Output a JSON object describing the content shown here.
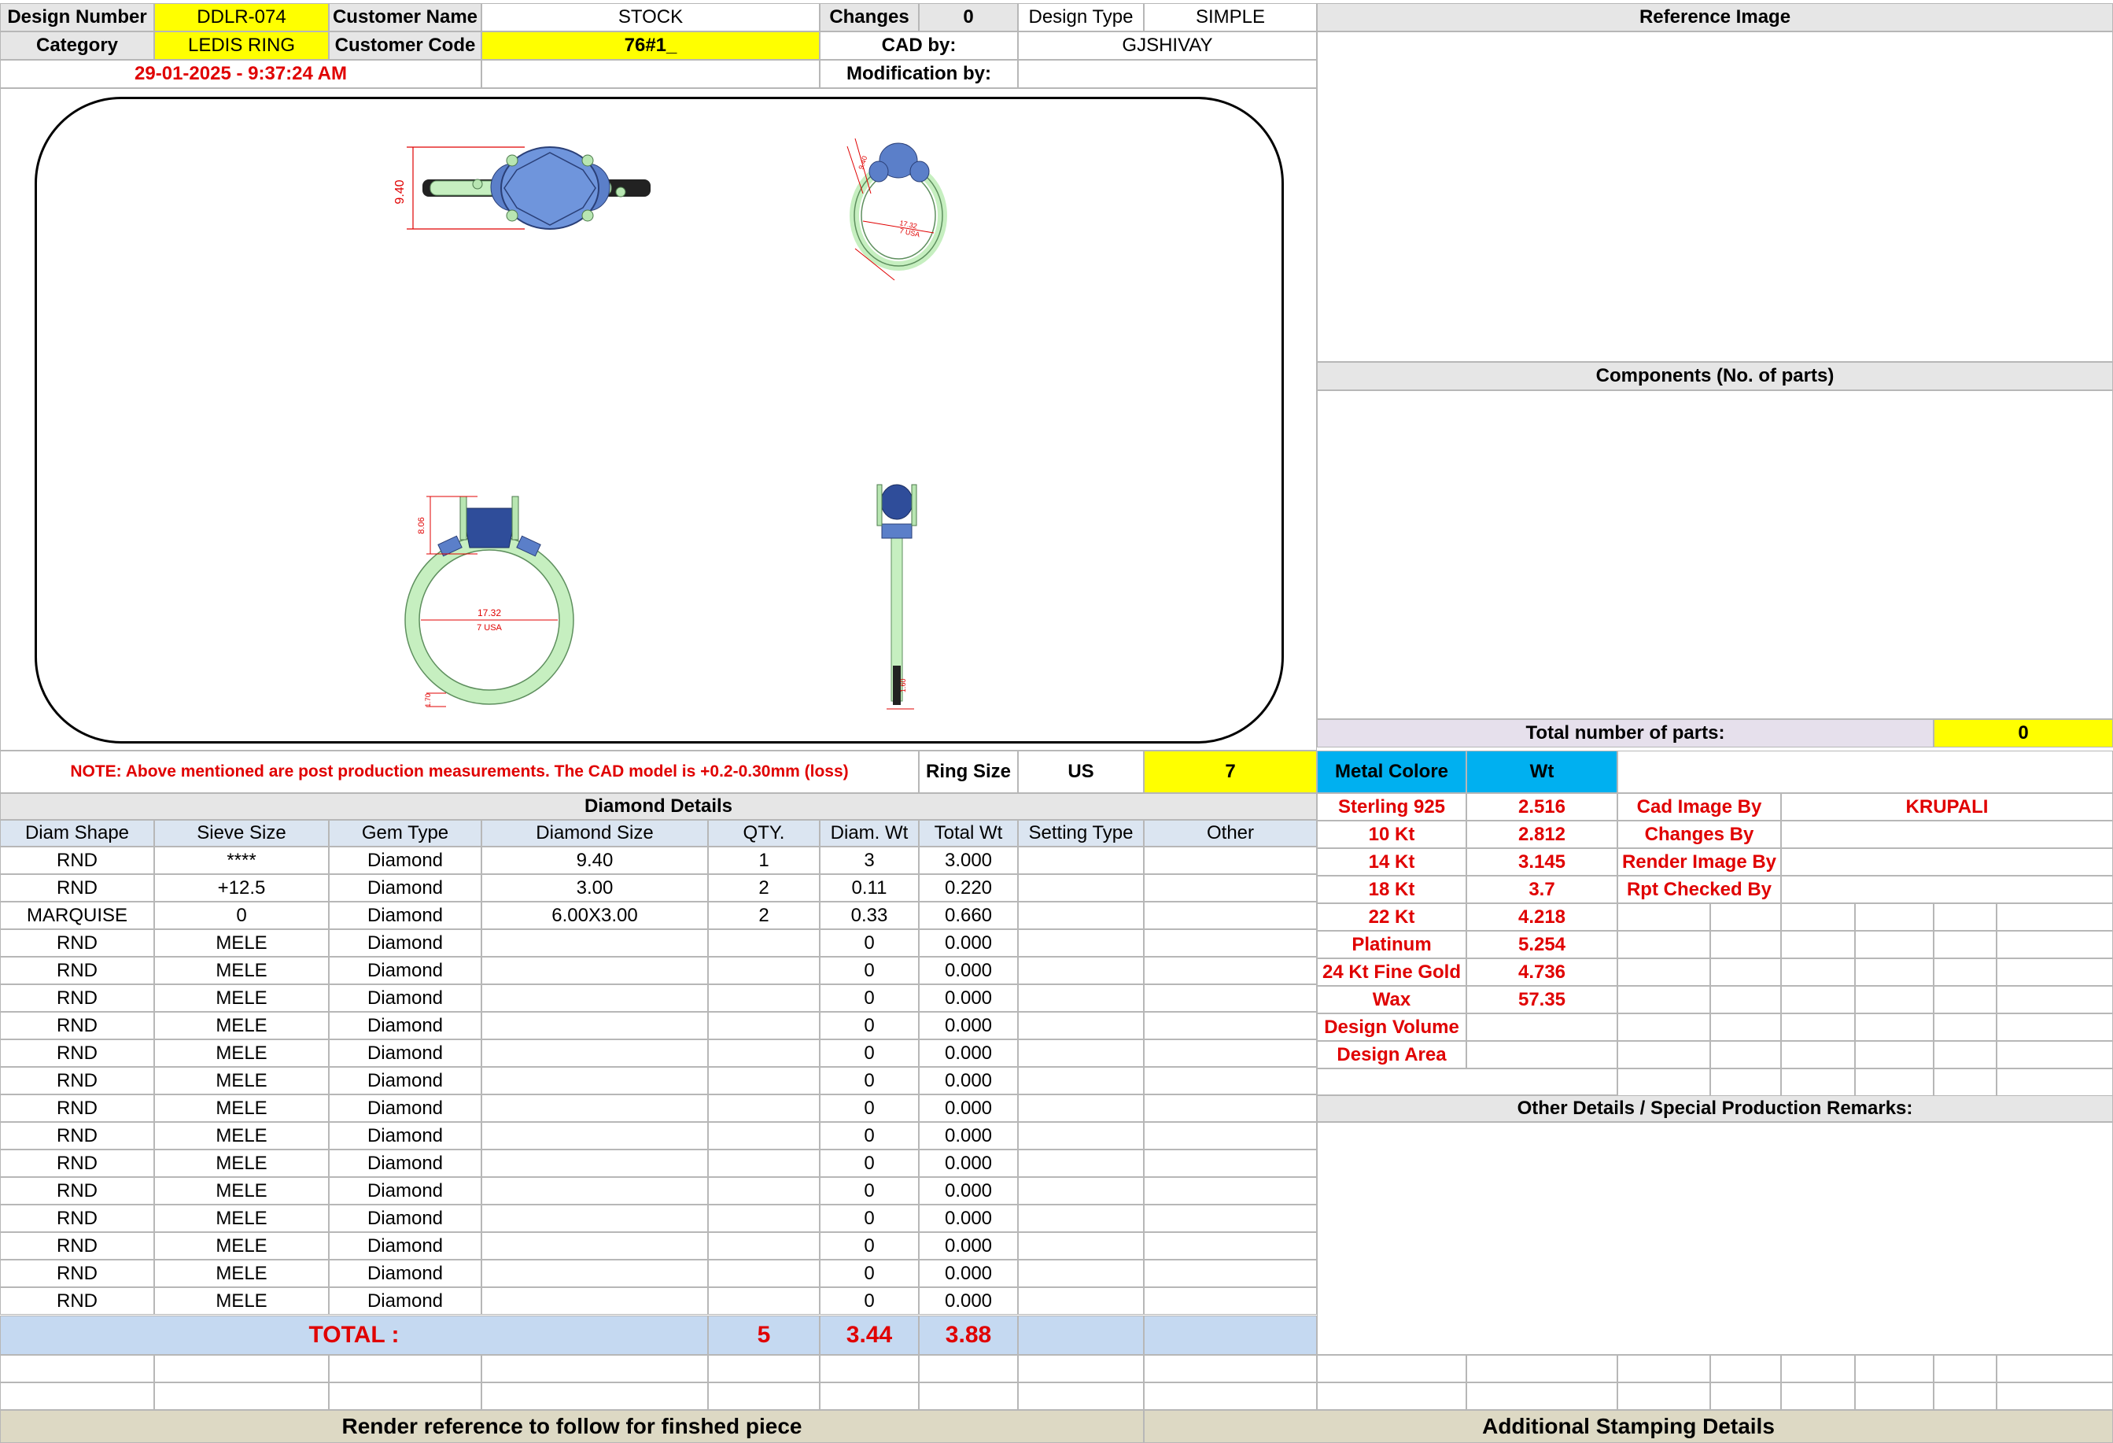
{
  "header": {
    "design_number_label": "Design Number",
    "design_number": "DDLR-074",
    "customer_name_label": "Customer Name",
    "customer_name": "STOCK",
    "changes_label": "Changes",
    "changes": "0",
    "design_type_label": "Design Type",
    "design_type": "SIMPLE",
    "category_label": "Category",
    "category": "LEDIS RING",
    "customer_code_label": "Customer Code",
    "customer_code": "76#1_",
    "cad_by_label": "CAD by:",
    "cad_by": "GJSHIVAY",
    "timestamp": "29-01-2025 - 9:37:24 AM",
    "modification_label": "Modification by:",
    "modification": ""
  },
  "drawing": {
    "top_view": {
      "height_dim": "9.40"
    },
    "iso_view": {
      "height_dim": "9.40",
      "inner_dim": "17.32",
      "size_dim": "7 USA"
    },
    "front_view": {
      "height_dim": "8.06",
      "inner_dim": "17.32",
      "size_dim": "7 USA",
      "band_dim": "1.70"
    },
    "side_view": {
      "band_dim": "1.60"
    }
  },
  "note": "NOTE: Above mentioned are post production measurements. The CAD model is +0.2-0.30mm (loss)",
  "ring_size": {
    "label": "Ring Size",
    "system": "US",
    "value": "7"
  },
  "reference_image_title": "Reference Image",
  "components_title": "Components (No. of parts)",
  "total_parts": {
    "label": "Total number of parts:",
    "value": "0"
  },
  "diamond_details": {
    "title": "Diamond Details",
    "columns": [
      "Diam Shape",
      "Sieve Size",
      "Gem Type",
      "Diamond Size",
      "QTY.",
      "Diam. Wt",
      "Total Wt",
      "Setting Type",
      "Other"
    ],
    "rows": [
      [
        "RND",
        "****",
        "Diamond",
        "9.40",
        "1",
        "3",
        "3.000",
        "",
        ""
      ],
      [
        "RND",
        "+12.5",
        "Diamond",
        "3.00",
        "2",
        "0.11",
        "0.220",
        "",
        ""
      ],
      [
        "MARQUISE",
        "0",
        "Diamond",
        "6.00X3.00",
        "2",
        "0.33",
        "0.660",
        "",
        ""
      ],
      [
        "RND",
        "MELE",
        "Diamond",
        "",
        "",
        "0",
        "0.000",
        "",
        ""
      ],
      [
        "RND",
        "MELE",
        "Diamond",
        "",
        "",
        "0",
        "0.000",
        "",
        ""
      ],
      [
        "RND",
        "MELE",
        "Diamond",
        "",
        "",
        "0",
        "0.000",
        "",
        ""
      ],
      [
        "RND",
        "MELE",
        "Diamond",
        "",
        "",
        "0",
        "0.000",
        "",
        ""
      ],
      [
        "RND",
        "MELE",
        "Diamond",
        "",
        "",
        "0",
        "0.000",
        "",
        ""
      ],
      [
        "RND",
        "MELE",
        "Diamond",
        "",
        "",
        "0",
        "0.000",
        "",
        ""
      ],
      [
        "RND",
        "MELE",
        "Diamond",
        "",
        "",
        "0",
        "0.000",
        "",
        ""
      ],
      [
        "RND",
        "MELE",
        "Diamond",
        "",
        "",
        "0",
        "0.000",
        "",
        ""
      ],
      [
        "RND",
        "MELE",
        "Diamond",
        "",
        "",
        "0",
        "0.000",
        "",
        ""
      ],
      [
        "RND",
        "MELE",
        "Diamond",
        "",
        "",
        "0",
        "0.000",
        "",
        ""
      ],
      [
        "RND",
        "MELE",
        "Diamond",
        "",
        "",
        "0",
        "0.000",
        "",
        ""
      ],
      [
        "RND",
        "MELE",
        "Diamond",
        "",
        "",
        "0",
        "0.000",
        "",
        ""
      ],
      [
        "RND",
        "MELE",
        "Diamond",
        "",
        "",
        "0",
        "0.000",
        "",
        ""
      ],
      [
        "RND",
        "MELE",
        "Diamond",
        "",
        "",
        "0",
        "0.000",
        "",
        ""
      ]
    ],
    "total_label": "TOTAL :",
    "total_qty": "5",
    "total_diam_wt": "3.44",
    "total_wt": "3.88"
  },
  "metal": {
    "header_label": "Metal Colore",
    "wt_label": "Wt",
    "rows": [
      {
        "name": "Sterling 925",
        "wt": "2.516"
      },
      {
        "name": "10 Kt",
        "wt": "2.812"
      },
      {
        "name": "14 Kt",
        "wt": "3.145"
      },
      {
        "name": "18 Kt",
        "wt": "3.7"
      },
      {
        "name": "22 Kt",
        "wt": "4.218"
      },
      {
        "name": "Platinum",
        "wt": "5.254"
      },
      {
        "name": "24 Kt Fine Gold",
        "wt": "4.736"
      },
      {
        "name": "Wax",
        "wt": "57.35"
      },
      {
        "name": "Design Volume",
        "wt": ""
      },
      {
        "name": "Design Area",
        "wt": ""
      }
    ]
  },
  "credits": [
    {
      "label": "Cad Image By",
      "value": "KRUPALI"
    },
    {
      "label": "Changes By",
      "value": ""
    },
    {
      "label": "Render Image By",
      "value": ""
    },
    {
      "label": "Rpt Checked By",
      "value": ""
    }
  ],
  "other_details_title": "Other Details / Special Production Remarks:",
  "footer": {
    "render_reference": "Render reference to follow for finshed piece",
    "stamping": "Additional Stamping Details"
  },
  "colors": {
    "yellow": "#ffff00",
    "light_blue": "#dbe5f1",
    "cyan": "#00b0f0",
    "red": "#e00000",
    "tan": "#ddd9c4",
    "metal_green": "#c6efc0",
    "stone_blue": "#5b7fc9"
  }
}
